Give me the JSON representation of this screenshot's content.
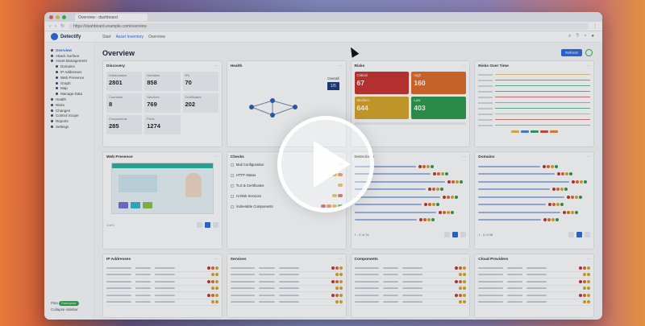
{
  "browser": {
    "tab_title": "Overview - dashboard",
    "url": "https://dashboard.example.com/overview"
  },
  "app": {
    "brand": "Detectify",
    "breadcrumbs": [
      "Start",
      "Asset Inventory",
      "Overview"
    ]
  },
  "sidebar": {
    "items": [
      {
        "label": "Overview",
        "active": true,
        "sub": false
      },
      {
        "label": "Attack Surface",
        "active": false,
        "sub": false
      },
      {
        "label": "Asset Management",
        "active": false,
        "sub": false
      },
      {
        "label": "Domains",
        "active": false,
        "sub": true
      },
      {
        "label": "IP Addresses",
        "active": false,
        "sub": true
      },
      {
        "label": "Web Presence",
        "active": false,
        "sub": true
      },
      {
        "label": "Graph",
        "active": false,
        "sub": true
      },
      {
        "label": "Map",
        "active": false,
        "sub": true
      },
      {
        "label": "Manage Data",
        "active": false,
        "sub": true
      },
      {
        "label": "Health",
        "active": false,
        "sub": false
      },
      {
        "label": "Risks",
        "active": false,
        "sub": false
      },
      {
        "label": "Changes",
        "active": false,
        "sub": false
      },
      {
        "label": "Control Scope",
        "active": false,
        "sub": false
      },
      {
        "label": "Reports",
        "active": false,
        "sub": false
      },
      {
        "label": "Settings",
        "active": false,
        "sub": false
      }
    ],
    "footer_label": "Plan",
    "footer_badge": "Enterprise",
    "collapse_label": "Collapse sidebar"
  },
  "page": {
    "title": "Overview",
    "refresh_label": "Refresh"
  },
  "discovery": {
    "title": "Discovery",
    "cells": [
      {
        "label": "Subdomains",
        "value": "2801"
      },
      {
        "label": "Domains",
        "value": "858"
      },
      {
        "label": "IPs",
        "value": "70"
      },
      {
        "label": "Countries",
        "value": "8"
      },
      {
        "label": "Services",
        "value": "769"
      },
      {
        "label": "Certificates",
        "value": "202"
      },
      {
        "label": "Components",
        "value": "285"
      },
      {
        "label": "Ports",
        "value": "1274"
      }
    ]
  },
  "health": {
    "title": "Health",
    "overall_label": "Overall",
    "overall_value": "1/5"
  },
  "risks": {
    "title": "Risks",
    "boxes": [
      {
        "label": "Critical",
        "value": "67",
        "color": "#c9342f"
      },
      {
        "label": "High",
        "value": "160",
        "color": "#e06b2a"
      },
      {
        "label": "Medium",
        "value": "644",
        "color": "#d8a72a"
      },
      {
        "label": "Low",
        "value": "403",
        "color": "#2e9a4d"
      }
    ]
  },
  "risks_over_time": {
    "title": "Risks Over Time",
    "series_colors": [
      "#e7b84d",
      "#4a86d6",
      "#2fa36e",
      "#d44b40",
      "#e5873b"
    ]
  },
  "web_presence": {
    "title": "Web Presence",
    "page_label": "1 of 1"
  },
  "checks": {
    "title": "Checks",
    "items": [
      "Mail Configuration",
      "HTTP Status",
      "TLS & Certificates",
      "At Risk Services",
      "Vulnerable Components"
    ]
  },
  "detections": {
    "title": "Detections",
    "page_label": "1 - 5 of 15"
  },
  "domains": {
    "title": "Domains",
    "page_label": "1 - 5 of 58"
  },
  "ip_addresses": {
    "title": "IP Addresses"
  },
  "services": {
    "title": "Services"
  },
  "components": {
    "title": "Components"
  },
  "cloud_providers": {
    "title": "Cloud Providers"
  }
}
